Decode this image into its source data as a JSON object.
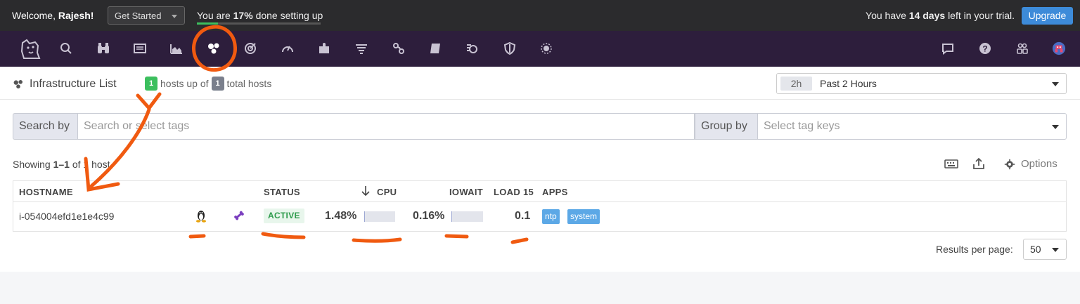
{
  "topbar": {
    "welcome_prefix": "Welcome,",
    "user_name": "Rajesh!",
    "get_started_label": "Get Started",
    "progress_prefix": "You are",
    "progress_percent_text": "17%",
    "progress_suffix": "done setting up",
    "progress_fraction": 0.17,
    "trial_prefix": "You have",
    "trial_days": "14 days",
    "trial_suffix": "left in your trial.",
    "upgrade_label": "Upgrade"
  },
  "nav": {
    "icons": [
      "datadog-logo-icon",
      "search-icon",
      "binoculars-icon",
      "dashboard-icon",
      "metrics-chart-icon",
      "infrastructure-icon",
      "monitors-icon",
      "apm-gauge-icon",
      "integrations-puzzle-icon",
      "logs-filter-icon",
      "network-icon",
      "notebooks-icon",
      "synthetics-icon",
      "security-shield-icon",
      "bits-icon",
      "chat-icon",
      "help-icon",
      "team-icon",
      "user-avatar-icon"
    ],
    "active": "infrastructure-icon"
  },
  "header": {
    "title": "Infrastructure List",
    "hosts_up_count": "1",
    "hosts_up_text": "hosts up of",
    "total_hosts_count": "1",
    "total_hosts_text": "total hosts",
    "time_pill": "2h",
    "time_label": "Past 2 Hours"
  },
  "filters": {
    "search_label": "Search by",
    "search_placeholder": "Search or select tags",
    "group_label": "Group by",
    "group_placeholder": "Select tag keys"
  },
  "list": {
    "showing_prefix": "Showing",
    "showing_range": "1–1",
    "showing_suffix": "of 1 host",
    "options_label": "Options",
    "columns": [
      "HOSTNAME",
      "STATUS",
      "CPU",
      "IOWAIT",
      "LOAD 15",
      "APPS"
    ],
    "rows": [
      {
        "hostname": "i-054004efd1e1e4c99",
        "status": "ACTIVE",
        "cpu": "1.48%",
        "cpu_fraction": 0.0148,
        "iowait": "0.16%",
        "iowait_fraction": 0.0016,
        "load15": "0.1",
        "apps": [
          "ntp",
          "system"
        ]
      }
    ],
    "per_page_label": "Results per page:",
    "per_page_value": "50"
  },
  "colors": {
    "topbar": "#2b2b2d",
    "navbar": "#2d1e3c",
    "accent_blue": "#3d8bd9",
    "green": "#3cbf5e",
    "annotation_orange": "#f05a10",
    "app_tag": "#5ca8e6"
  }
}
